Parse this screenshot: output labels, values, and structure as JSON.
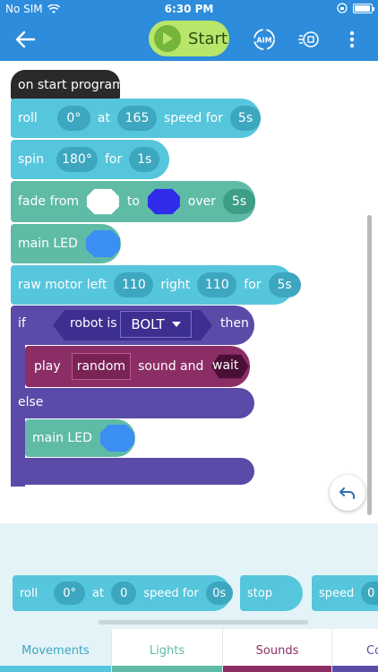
{
  "status": {
    "carrier": "No SIM",
    "time": "6:30 PM"
  },
  "toolbar": {
    "start_label": "Start",
    "aim_label": "AIM"
  },
  "program": {
    "hat": "on start program",
    "roll": {
      "label": "roll",
      "heading": "0°",
      "at": "at",
      "speed": "165",
      "speed_for": "speed for",
      "duration": "5s"
    },
    "spin": {
      "label": "spin",
      "angle": "180°",
      "for": "for",
      "duration": "1s"
    },
    "fade": {
      "label": "fade from",
      "to": "to",
      "over": "over",
      "duration": "5s",
      "from_color": "#ffffff",
      "to_color": "#2f2be8"
    },
    "main_led": {
      "label": "main LED",
      "color": "#3b8ef2"
    },
    "raw_motor": {
      "label": "raw motor left",
      "left": "110",
      "right_label": "right",
      "right": "110",
      "for": "for",
      "duration": "5s"
    },
    "if_block": {
      "if": "if",
      "robot_is": "robot is",
      "robot": "BOLT",
      "then": "then",
      "else": "else"
    },
    "play": {
      "label": "play",
      "sound": "random",
      "sound_and": "sound and",
      "wait": "wait"
    },
    "else_led": {
      "label": "main LED",
      "color": "#3b8ef2"
    }
  },
  "palette": {
    "roll": {
      "label": "roll",
      "heading": "0°",
      "at": "at",
      "speed": "0",
      "speed_for": "speed for",
      "duration": "0s"
    },
    "stop": "stop",
    "speed": {
      "label": "speed",
      "value": "0"
    }
  },
  "tabs": [
    {
      "label": "Movements",
      "color": "#56c6dc",
      "text": "#3ca7bf"
    },
    {
      "label": "Lights",
      "color": "#5fbba6",
      "text": "#5fbba6"
    },
    {
      "label": "Sounds",
      "color": "#8c2e66",
      "text": "#8c2e66"
    },
    {
      "label": "Co",
      "color": "#5b4aa8",
      "text": "#5b4aa8"
    }
  ]
}
